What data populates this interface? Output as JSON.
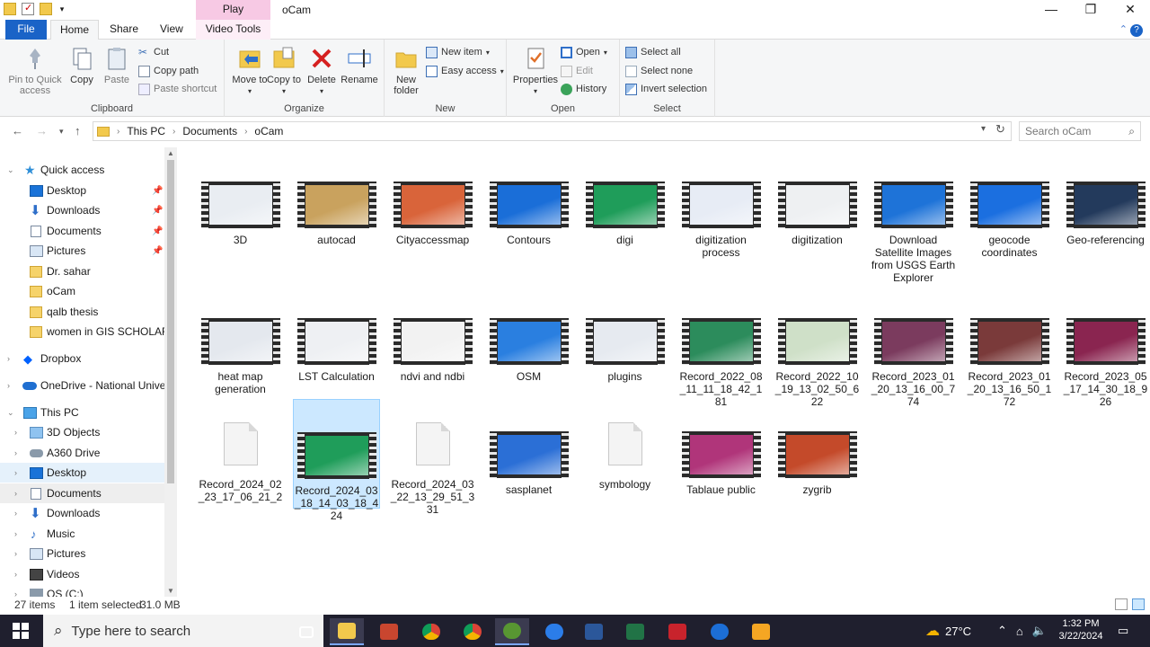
{
  "window": {
    "title": "oCam",
    "contextual_tab_group": "Play",
    "controls": {
      "minimize": "—",
      "maximize": "❐",
      "close": "✕"
    }
  },
  "ribbon_tabs": {
    "file": "File",
    "home": "Home",
    "share": "Share",
    "view": "View",
    "video_tools": "Video Tools"
  },
  "ribbon": {
    "clipboard": {
      "label": "Clipboard",
      "pin": "Pin to Quick access",
      "copy": "Copy",
      "paste": "Paste",
      "cut": "Cut",
      "copy_path": "Copy path",
      "paste_shortcut": "Paste shortcut"
    },
    "organize": {
      "label": "Organize",
      "move_to": "Move to",
      "copy_to": "Copy to",
      "delete": "Delete",
      "rename": "Rename"
    },
    "new": {
      "label": "New",
      "new_folder": "New folder",
      "new_item": "New item",
      "easy_access": "Easy access"
    },
    "open": {
      "label": "Open",
      "properties": "Properties",
      "open": "Open",
      "edit": "Edit",
      "history": "History"
    },
    "select": {
      "label": "Select",
      "select_all": "Select all",
      "select_none": "Select none",
      "invert_selection": "Invert selection"
    }
  },
  "address": {
    "crumbs": [
      "This PC",
      "Documents",
      "oCam"
    ],
    "search_placeholder": "Search oCam"
  },
  "nav": {
    "quick_access": "Quick access",
    "quick_items": [
      {
        "label": "Desktop",
        "pinned": true
      },
      {
        "label": "Downloads",
        "pinned": true
      },
      {
        "label": "Documents",
        "pinned": true
      },
      {
        "label": "Pictures",
        "pinned": true
      },
      {
        "label": "Dr. sahar",
        "pinned": false
      },
      {
        "label": "oCam",
        "pinned": false
      },
      {
        "label": "qalb thesis",
        "pinned": false
      },
      {
        "label": "women in GIS SCHOLARSH",
        "pinned": false
      }
    ],
    "dropbox": "Dropbox",
    "onedrive": "OneDrive - National Univers",
    "this_pc": "This PC",
    "pc_items": [
      "3D Objects",
      "A360 Drive",
      "Desktop",
      "Documents",
      "Downloads",
      "Music",
      "Pictures",
      "Videos",
      "OS (C:)"
    ]
  },
  "files": [
    {
      "name": "3D",
      "kind": "video",
      "tone": "#e9edf2"
    },
    {
      "name": "autocad",
      "kind": "video",
      "tone": "#c9a25e"
    },
    {
      "name": "Cityaccessmap",
      "kind": "video",
      "tone": "#d9643a"
    },
    {
      "name": "Contours",
      "kind": "video",
      "tone": "#1a6ed8"
    },
    {
      "name": "digi",
      "kind": "video",
      "tone": "#1f9d5a"
    },
    {
      "name": "digitization process",
      "kind": "video",
      "tone": "#e7ecf5"
    },
    {
      "name": "digitization",
      "kind": "video",
      "tone": "#eef0f2"
    },
    {
      "name": "Download Satellite Images from USGS Earth Explorer",
      "kind": "video",
      "tone": "#1e73d8"
    },
    {
      "name": "geocode coordinates",
      "kind": "video",
      "tone": "#1b6fe0"
    },
    {
      "name": "Geo-referencing",
      "kind": "video",
      "tone": "#233a5c"
    },
    {
      "name": "heat map generation",
      "kind": "video",
      "tone": "#e4e8ee"
    },
    {
      "name": "LST Calculation",
      "kind": "video",
      "tone": "#eef0f3"
    },
    {
      "name": "ndvi and ndbi",
      "kind": "video",
      "tone": "#f2f2f2"
    },
    {
      "name": "OSM",
      "kind": "video",
      "tone": "#2a7fe0"
    },
    {
      "name": "plugins",
      "kind": "video",
      "tone": "#e6eaf0"
    },
    {
      "name": "Record_2022_08_11_11_18_42_181",
      "kind": "video",
      "tone": "#2c8c5c"
    },
    {
      "name": "Record_2022_10_19_13_02_50_622",
      "kind": "video",
      "tone": "#cfe0c8"
    },
    {
      "name": "Record_2023_01_20_13_16_00_774",
      "kind": "video",
      "tone": "#7b3b5e"
    },
    {
      "name": "Record_2023_01_20_13_16_50_172",
      "kind": "video",
      "tone": "#7a3a3a"
    },
    {
      "name": "Record_2023_05_17_14_30_18_926",
      "kind": "video",
      "tone": "#8a2550"
    },
    {
      "name": "Record_2024_02_23_17_06_21_2",
      "kind": "doc",
      "tone": "#f4f4f4"
    },
    {
      "name": "Record_2024_03_18_14_03_18_424",
      "kind": "video",
      "tone": "#1f9d5a",
      "selected": true
    },
    {
      "name": "Record_2024_03_22_13_29_51_331",
      "kind": "doc",
      "tone": "#f4f4f4"
    },
    {
      "name": "sasplanet",
      "kind": "video",
      "tone": "#2b6fd6"
    },
    {
      "name": "symbology",
      "kind": "doc",
      "tone": "#f4f4f4"
    },
    {
      "name": "Tablaue public",
      "kind": "video",
      "tone": "#b0357a"
    },
    {
      "name": "zygrib",
      "kind": "video",
      "tone": "#c44a2a"
    }
  ],
  "status": {
    "count": "27 items",
    "selection": "1 item selected",
    "size": "31.0 MB"
  },
  "taskbar": {
    "search_placeholder": "Type here to search",
    "weather": "27°C",
    "time": "1:32 PM",
    "date": "3/22/2024"
  }
}
